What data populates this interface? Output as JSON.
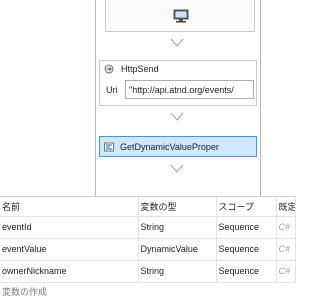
{
  "designer": {
    "http_send": {
      "title": "HttpSend",
      "uri_label": "Uri",
      "uri_value": "\"http://api.atnd.org/events/"
    },
    "get_dynamic": {
      "title": "GetDynamicValueProper"
    }
  },
  "variables": {
    "columns": [
      "名前",
      "変数の型",
      "スコープ",
      "既定"
    ],
    "rows": [
      {
        "name": "eventId",
        "type": "String",
        "scope": "Sequence",
        "default": "C#"
      },
      {
        "name": "eventValue",
        "type": "DynamicValue",
        "scope": "Sequence",
        "default": "C#"
      },
      {
        "name": "ownerNickname",
        "type": "String",
        "scope": "Sequence",
        "default": "C#"
      }
    ],
    "create_label": "変数の作成"
  },
  "colors": {
    "selection_fill": "#cde8ff",
    "selection_border": "#3399ff",
    "grid_line": "#e3e3e3"
  },
  "icons": {
    "top_activity": "monitor-icon",
    "http_send": "http-send-icon",
    "get_dynamic": "assign-icon",
    "connector": "chevron-down-icon"
  }
}
